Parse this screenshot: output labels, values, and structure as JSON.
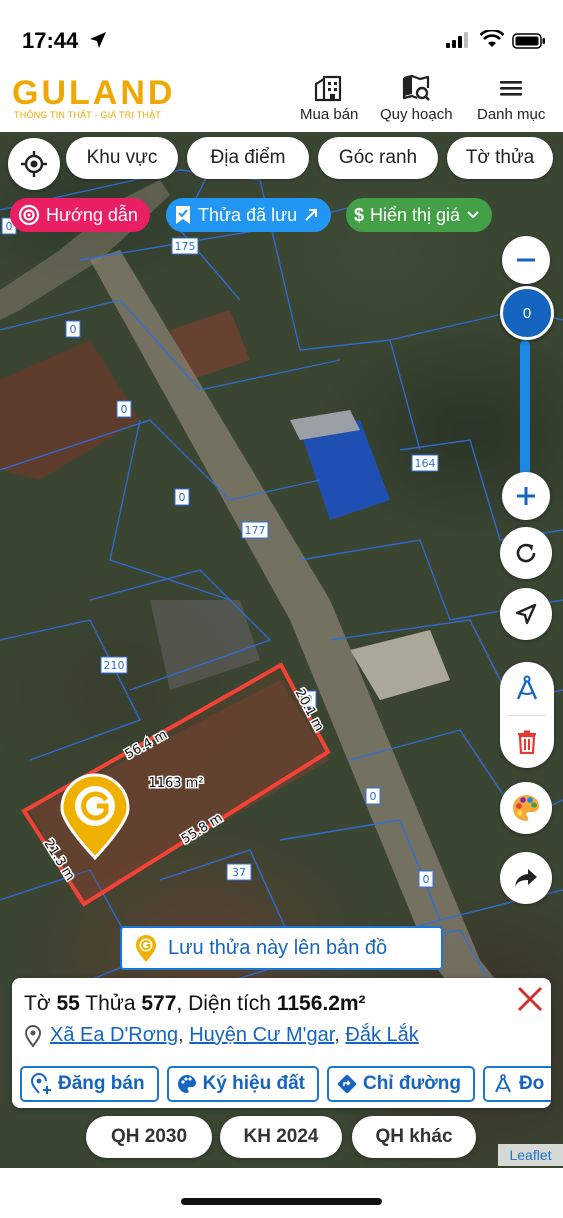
{
  "status": {
    "time": "17:44"
  },
  "header": {
    "logo": "GULAND",
    "tagline": "THÔNG TIN THẬT - GIÁ TRỊ THẬT",
    "nav": [
      "Mua bán",
      "Quy hoạch",
      "Danh mục"
    ]
  },
  "filters": [
    "Khu vực",
    "Địa điểm",
    "Góc ranh",
    "Tờ thửa"
  ],
  "tags": {
    "guide": "Hướng dẫn",
    "saved": "Thửa đã lưu",
    "price": "Hiển thị giá"
  },
  "zoom": {
    "level": "0",
    "fill_fraction": 1.0
  },
  "map": {
    "parcel_numbers": [
      "0",
      "175",
      "0",
      "0",
      "0",
      "177",
      "164",
      "210",
      "0",
      "0",
      "37",
      "0"
    ],
    "selected_parcel": {
      "area_label": "1163 m²",
      "edges": [
        "56.4 m",
        "20.1 m",
        "55.8 m",
        "21.3 m"
      ]
    }
  },
  "save_banner": "Lưu thửa này lên bản đồ",
  "info": {
    "sheet_label": "Tờ",
    "sheet": "55",
    "parcel_label": "Thửa",
    "parcel": "577",
    "area_label": "Diện tích",
    "area": "1156.2m²",
    "commune": "Xã Ea D'Rơng",
    "district": "Huyện Cư M'gar",
    "province": "Đắk Lắk",
    "actions": [
      "Đăng bán",
      "Ký hiệu đất",
      "Chỉ đường",
      "Đo"
    ]
  },
  "bottom_layers": [
    "QH 2030",
    "KH 2024",
    "QH khác"
  ],
  "attribution": "Leaflet",
  "colors": {
    "brand": "#f0a800",
    "primary": "#1976d2",
    "guide_tag": "#e91e63",
    "saved_tag": "#2196f3",
    "price_tag": "#43a047",
    "parcel_outline": "#f44336"
  }
}
